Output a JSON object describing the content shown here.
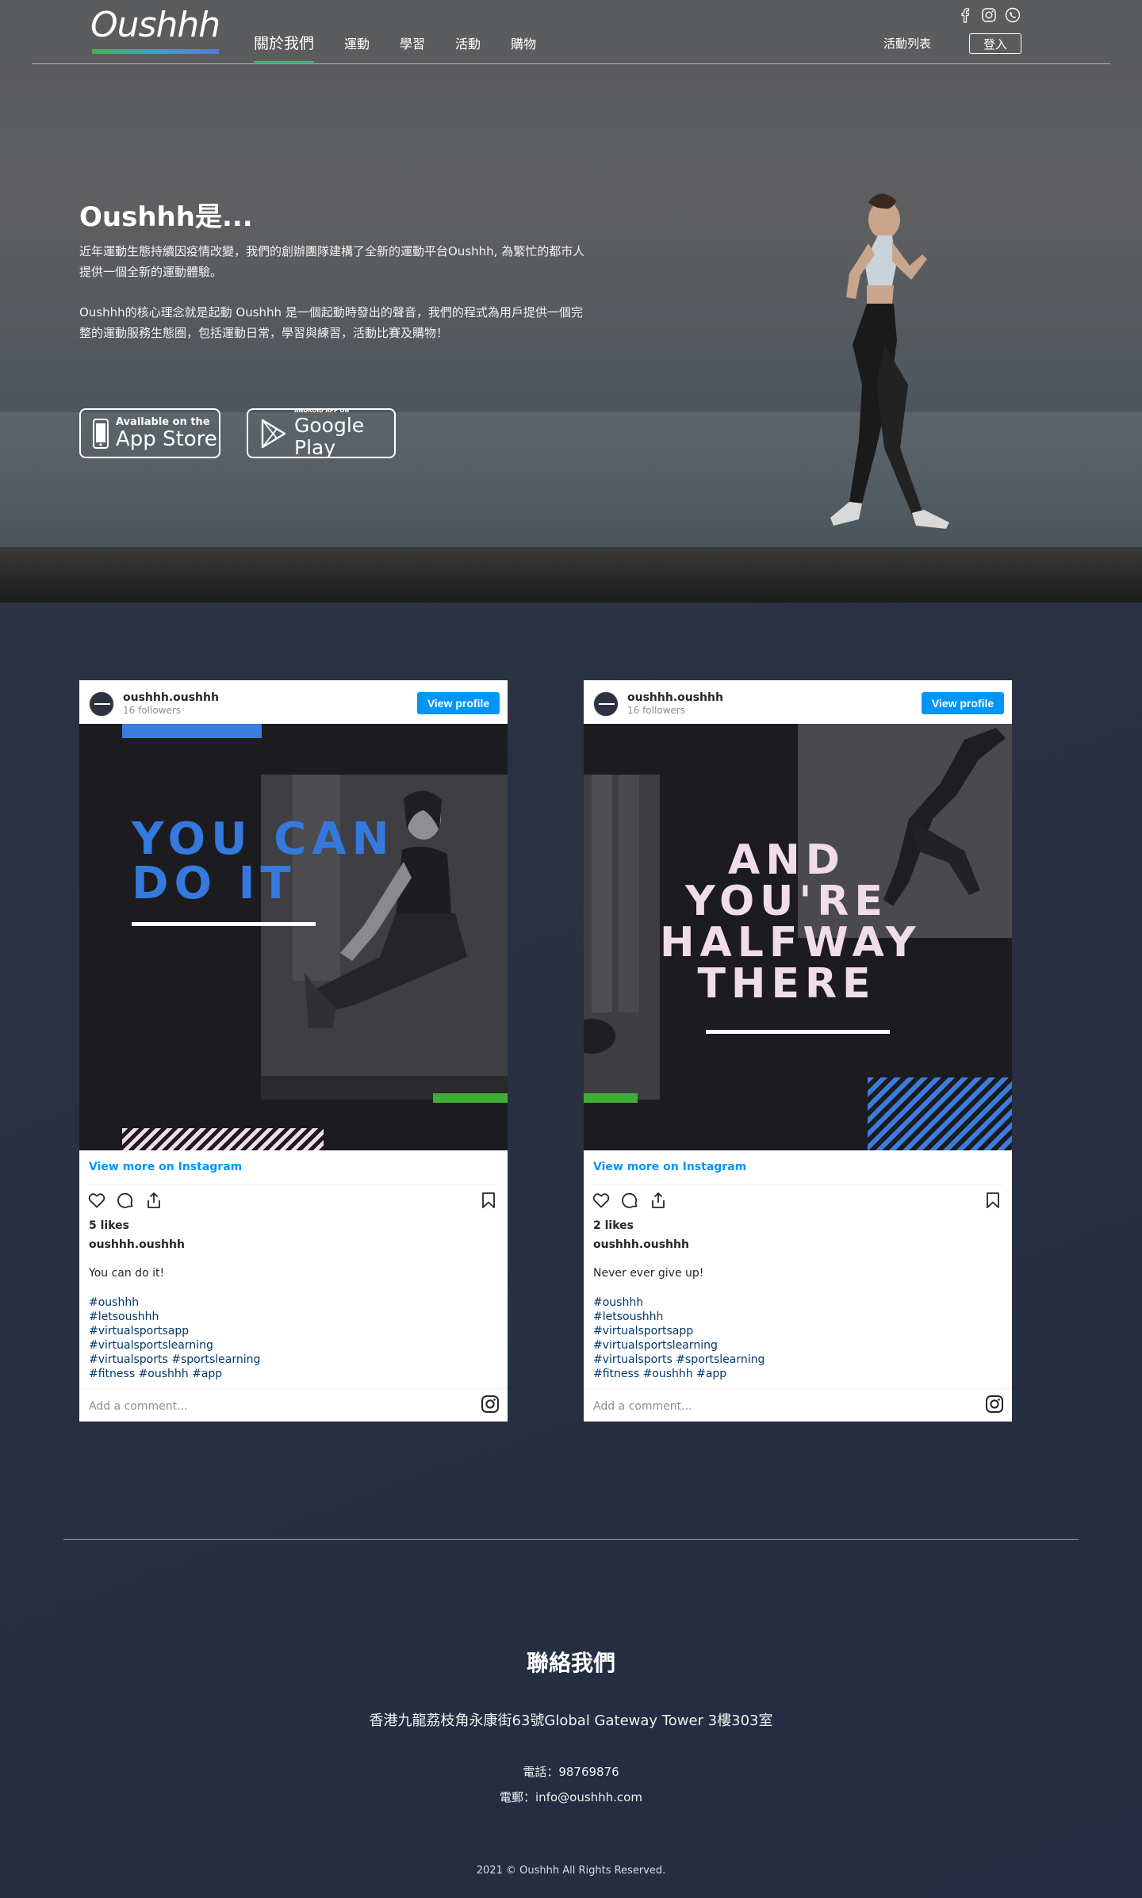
{
  "header": {
    "logo": "Oushhh",
    "nav": [
      "關於我們",
      "運動",
      "學習",
      "活動",
      "購物"
    ],
    "event_list": "活動列表",
    "login": "登入",
    "social_icons": [
      "facebook-icon",
      "instagram-icon",
      "whatsapp-icon"
    ]
  },
  "hero": {
    "title": "Oushhh是...",
    "p1": "近年運動生態持續因疫情改變，我們的創辦團隊建構了全新的運動平台Oushhh, 為繁忙的都市人提供一個全新的運動體驗。",
    "p2": "Oushhh的核心理念就是起動 Oushhh 是一個起動時發出的聲音，我們的程式為用戶提供一個完整的運動服務生態圈，包括運動日常，學習與練習，活動比賽及購物！",
    "app_store": {
      "small": "Available on the",
      "big": "App Store"
    },
    "google_play": {
      "small": "ANDROID APP ON",
      "big": "Google Play"
    }
  },
  "posts": [
    {
      "username": "oushhh.oushhh",
      "followers": "16 followers",
      "view_profile": "View profile",
      "image_text": [
        "YOU CAN",
        "DO IT"
      ],
      "view_more": "View more on Instagram",
      "likes": "5 likes",
      "caption_user": "oushhh.oushhh",
      "caption": "You can do it!",
      "tags": [
        "#oushhh",
        "#letsoushhh",
        "#virtualsportsapp",
        "#virtualsportslearning",
        "#virtualsports #sportslearning",
        "#fitness #oushhh #app"
      ],
      "comment_placeholder": "Add a comment..."
    },
    {
      "username": "oushhh.oushhh",
      "followers": "16 followers",
      "view_profile": "View profile",
      "image_text": [
        "AND",
        "YOU'RE",
        "HALFWAY",
        "THERE"
      ],
      "view_more": "View more on Instagram",
      "likes": "2 likes",
      "caption_user": "oushhh.oushhh",
      "caption": "Never ever give up!",
      "tags": [
        "#oushhh",
        "#letsoushhh",
        "#virtualsportsapp",
        "#virtualsportslearning",
        "#virtualsports #sportslearning",
        "#fitness #oushhh #app"
      ],
      "comment_placeholder": "Add a comment..."
    }
  ],
  "footer": {
    "title": "聯絡我們",
    "address": "香港九龍荔枝角永康街63號Global Gateway Tower 3樓303室",
    "phone": "電話：98769876",
    "email": "電郵：info@oushhh.com",
    "copyright": "2021 © Oushhh All Rights Reserved."
  },
  "colors": {
    "instagram_blue": "#0095f6",
    "post1_text": "#3579dc",
    "post2_text": "#f1dcea",
    "accent_green": "#3fae36"
  }
}
